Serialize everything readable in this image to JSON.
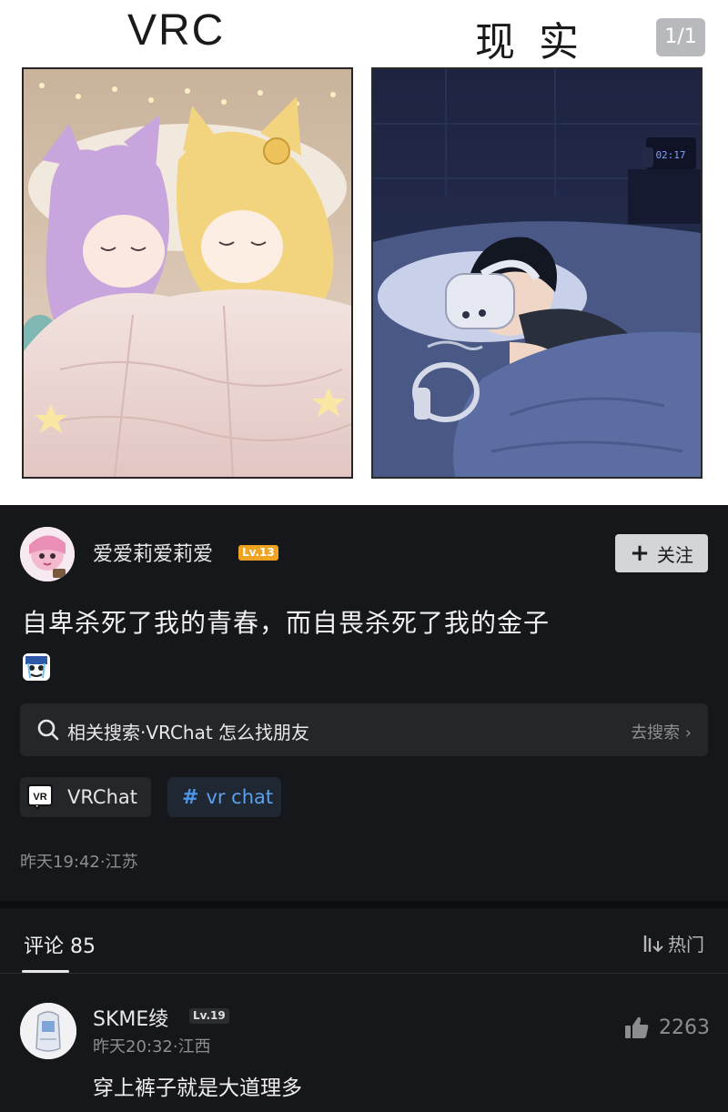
{
  "image_header": {
    "left_label": "VRC",
    "right_label": "现 实",
    "page_counter": "1/1"
  },
  "post": {
    "username": "爱爱莉爱莉爱",
    "level": "Lv.13",
    "follow_label": "关注",
    "text": "自卑杀死了我的青春，而自畏杀死了我的金子",
    "related_search": "相关搜索·VRChat 怎么找朋友",
    "search_go": "去搜索",
    "tags": [
      {
        "label": "VRChat"
      },
      {
        "label": "vr chat"
      }
    ],
    "vr_logo_text": "VR",
    "meta": "昨天19:42·江苏"
  },
  "comments": {
    "title": "评论  85",
    "sort_label": "热门",
    "items": [
      {
        "username": "SKME绫",
        "level": "Lv.19",
        "meta": "昨天20:32·江西",
        "text": "穿上裤子就是大道理多",
        "likes": "2263"
      }
    ]
  },
  "colors": {
    "background": "#16171a",
    "tag_blue": "#5aa0ef",
    "level_badge": "#f0a321"
  }
}
